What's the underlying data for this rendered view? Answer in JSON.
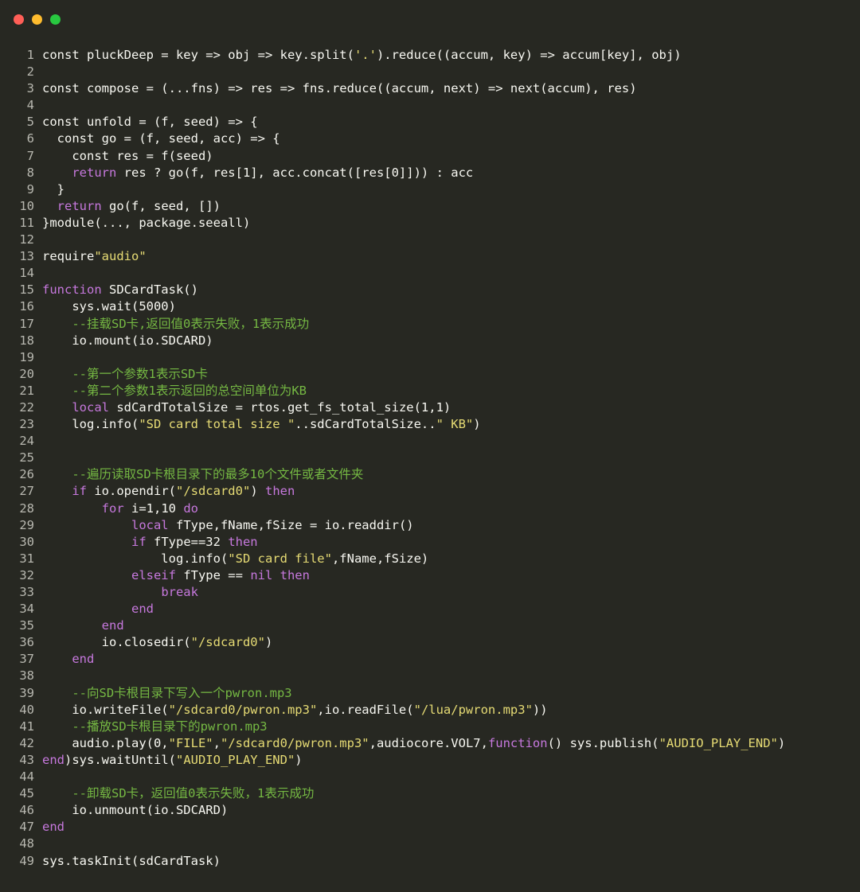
{
  "window": {
    "controls": [
      "close",
      "minimize",
      "maximize"
    ]
  },
  "colors": {
    "background": "#272822",
    "text": "#f8f8f2",
    "keyword": "#c678dd",
    "string": "#e6db74",
    "comment": "#75b843",
    "line_number": "#b8b8b0"
  },
  "code_lines": [
    {
      "n": "1",
      "tokens": [
        {
          "t": "const pluckDeep = key => obj => key.split(",
          "c": "text"
        },
        {
          "t": "'.'",
          "c": "string"
        },
        {
          "t": ").reduce((accum, key) => accum[key], obj)",
          "c": "text"
        }
      ]
    },
    {
      "n": "2",
      "tokens": []
    },
    {
      "n": "3",
      "tokens": [
        {
          "t": "const compose = (...fns) => res => fns.reduce((accum, next) => next(accum), res)",
          "c": "text"
        }
      ]
    },
    {
      "n": "4",
      "tokens": []
    },
    {
      "n": "5",
      "tokens": [
        {
          "t": "const unfold = (f, seed) => {",
          "c": "text"
        }
      ]
    },
    {
      "n": "6",
      "tokens": [
        {
          "t": "  const go = (f, seed, acc) => {",
          "c": "text"
        }
      ]
    },
    {
      "n": "7",
      "tokens": [
        {
          "t": "    const res = f(seed)",
          "c": "text"
        }
      ]
    },
    {
      "n": "8",
      "tokens": [
        {
          "t": "    ",
          "c": "text"
        },
        {
          "t": "return",
          "c": "keyword"
        },
        {
          "t": " res ? go(f, res[1], acc.concat([res[0]])) : acc",
          "c": "text"
        }
      ]
    },
    {
      "n": "9",
      "tokens": [
        {
          "t": "  }",
          "c": "text"
        }
      ]
    },
    {
      "n": "10",
      "tokens": [
        {
          "t": "  ",
          "c": "text"
        },
        {
          "t": "return",
          "c": "keyword"
        },
        {
          "t": " go(f, seed, [])",
          "c": "text"
        }
      ]
    },
    {
      "n": "11",
      "tokens": [
        {
          "t": "}module(..., package.seeall)",
          "c": "text"
        }
      ]
    },
    {
      "n": "12",
      "tokens": []
    },
    {
      "n": "13",
      "tokens": [
        {
          "t": "require",
          "c": "text"
        },
        {
          "t": "\"audio\"",
          "c": "string"
        }
      ]
    },
    {
      "n": "14",
      "tokens": []
    },
    {
      "n": "15",
      "tokens": [
        {
          "t": "function",
          "c": "keyword"
        },
        {
          "t": " SDCardTask()",
          "c": "text"
        }
      ]
    },
    {
      "n": "16",
      "tokens": [
        {
          "t": "    sys.wait(5000)",
          "c": "text"
        }
      ]
    },
    {
      "n": "17",
      "tokens": [
        {
          "t": "    --挂载SD卡,返回值0表示失败，1表示成功",
          "c": "comment"
        }
      ]
    },
    {
      "n": "18",
      "tokens": [
        {
          "t": "    io.mount(io.SDCARD)",
          "c": "text"
        }
      ]
    },
    {
      "n": "19",
      "tokens": []
    },
    {
      "n": "20",
      "tokens": [
        {
          "t": "    --第一个参数1表示SD卡",
          "c": "comment"
        }
      ]
    },
    {
      "n": "21",
      "tokens": [
        {
          "t": "    --第二个参数1表示返回的总空间单位为KB",
          "c": "comment"
        }
      ]
    },
    {
      "n": "22",
      "tokens": [
        {
          "t": "    ",
          "c": "text"
        },
        {
          "t": "local",
          "c": "keyword"
        },
        {
          "t": " sdCardTotalSize = rtos.get_fs_total_size(1,1)",
          "c": "text"
        }
      ]
    },
    {
      "n": "23",
      "tokens": [
        {
          "t": "    log.info(",
          "c": "text"
        },
        {
          "t": "\"SD card total size \"",
          "c": "string"
        },
        {
          "t": "..sdCardTotalSize..",
          "c": "text"
        },
        {
          "t": "\" KB\"",
          "c": "string"
        },
        {
          "t": ")",
          "c": "text"
        }
      ]
    },
    {
      "n": "24",
      "tokens": []
    },
    {
      "n": "25",
      "tokens": []
    },
    {
      "n": "26",
      "tokens": [
        {
          "t": "    --遍历读取SD卡根目录下的最多10个文件或者文件夹",
          "c": "comment"
        }
      ]
    },
    {
      "n": "27",
      "tokens": [
        {
          "t": "    ",
          "c": "text"
        },
        {
          "t": "if",
          "c": "keyword"
        },
        {
          "t": " io.opendir(",
          "c": "text"
        },
        {
          "t": "\"/sdcard0\"",
          "c": "string"
        },
        {
          "t": ") ",
          "c": "text"
        },
        {
          "t": "then",
          "c": "keyword"
        }
      ]
    },
    {
      "n": "28",
      "tokens": [
        {
          "t": "        ",
          "c": "text"
        },
        {
          "t": "for",
          "c": "keyword"
        },
        {
          "t": " i=1,10 ",
          "c": "text"
        },
        {
          "t": "do",
          "c": "keyword"
        }
      ]
    },
    {
      "n": "29",
      "tokens": [
        {
          "t": "            ",
          "c": "text"
        },
        {
          "t": "local",
          "c": "keyword"
        },
        {
          "t": " fType,fName,fSize = io.readdir()",
          "c": "text"
        }
      ]
    },
    {
      "n": "30",
      "tokens": [
        {
          "t": "            ",
          "c": "text"
        },
        {
          "t": "if",
          "c": "keyword"
        },
        {
          "t": " fType==32 ",
          "c": "text"
        },
        {
          "t": "then",
          "c": "keyword"
        }
      ]
    },
    {
      "n": "31",
      "tokens": [
        {
          "t": "                log.info(",
          "c": "text"
        },
        {
          "t": "\"SD card file\"",
          "c": "string"
        },
        {
          "t": ",fName,fSize)",
          "c": "text"
        }
      ]
    },
    {
      "n": "32",
      "tokens": [
        {
          "t": "            ",
          "c": "text"
        },
        {
          "t": "elseif",
          "c": "keyword"
        },
        {
          "t": " fType == ",
          "c": "text"
        },
        {
          "t": "nil then",
          "c": "keyword"
        }
      ]
    },
    {
      "n": "33",
      "tokens": [
        {
          "t": "                ",
          "c": "text"
        },
        {
          "t": "break",
          "c": "keyword"
        }
      ]
    },
    {
      "n": "34",
      "tokens": [
        {
          "t": "            ",
          "c": "text"
        },
        {
          "t": "end",
          "c": "keyword"
        }
      ]
    },
    {
      "n": "35",
      "tokens": [
        {
          "t": "        ",
          "c": "text"
        },
        {
          "t": "end",
          "c": "keyword"
        }
      ]
    },
    {
      "n": "36",
      "tokens": [
        {
          "t": "        io.closedir(",
          "c": "text"
        },
        {
          "t": "\"/sdcard0\"",
          "c": "string"
        },
        {
          "t": ")",
          "c": "text"
        }
      ]
    },
    {
      "n": "37",
      "tokens": [
        {
          "t": "    ",
          "c": "text"
        },
        {
          "t": "end",
          "c": "keyword"
        }
      ]
    },
    {
      "n": "38",
      "tokens": []
    },
    {
      "n": "39",
      "tokens": [
        {
          "t": "    --向SD卡根目录下写入一个pwron.mp3",
          "c": "comment"
        }
      ]
    },
    {
      "n": "40",
      "tokens": [
        {
          "t": "    io.writeFile(",
          "c": "text"
        },
        {
          "t": "\"/sdcard0/pwron.mp3\"",
          "c": "string"
        },
        {
          "t": ",io.readFile(",
          "c": "text"
        },
        {
          "t": "\"/lua/pwron.mp3\"",
          "c": "string"
        },
        {
          "t": "))",
          "c": "text"
        }
      ]
    },
    {
      "n": "41",
      "tokens": [
        {
          "t": "    --播放SD卡根目录下的pwron.mp3",
          "c": "comment"
        }
      ]
    },
    {
      "n": "42",
      "tokens": [
        {
          "t": "    audio.play(0,",
          "c": "text"
        },
        {
          "t": "\"FILE\"",
          "c": "string"
        },
        {
          "t": ",",
          "c": "text"
        },
        {
          "t": "\"/sdcard0/pwron.mp3\"",
          "c": "string"
        },
        {
          "t": ",audiocore.VOL7,",
          "c": "text"
        },
        {
          "t": "function",
          "c": "keyword"
        },
        {
          "t": "() sys.publish(",
          "c": "text"
        },
        {
          "t": "\"AUDIO_PLAY_END\"",
          "c": "string"
        },
        {
          "t": ")",
          "c": "text"
        }
      ]
    },
    {
      "n": "43",
      "tokens": [
        {
          "t": "end",
          "c": "keyword"
        },
        {
          "t": ")sys.waitUntil(",
          "c": "text"
        },
        {
          "t": "\"AUDIO_PLAY_END\"",
          "c": "string"
        },
        {
          "t": ")",
          "c": "text"
        }
      ]
    },
    {
      "n": "44",
      "tokens": []
    },
    {
      "n": "45",
      "tokens": [
        {
          "t": "    --卸载SD卡，返回值0表示失败，1表示成功",
          "c": "comment"
        }
      ]
    },
    {
      "n": "46",
      "tokens": [
        {
          "t": "    io.unmount(io.SDCARD)",
          "c": "text"
        }
      ]
    },
    {
      "n": "47",
      "tokens": [
        {
          "t": "end",
          "c": "keyword"
        }
      ]
    },
    {
      "n": "48",
      "tokens": []
    },
    {
      "n": "49",
      "tokens": [
        {
          "t": "sys.taskInit(sdCardTask)",
          "c": "text"
        }
      ]
    }
  ]
}
